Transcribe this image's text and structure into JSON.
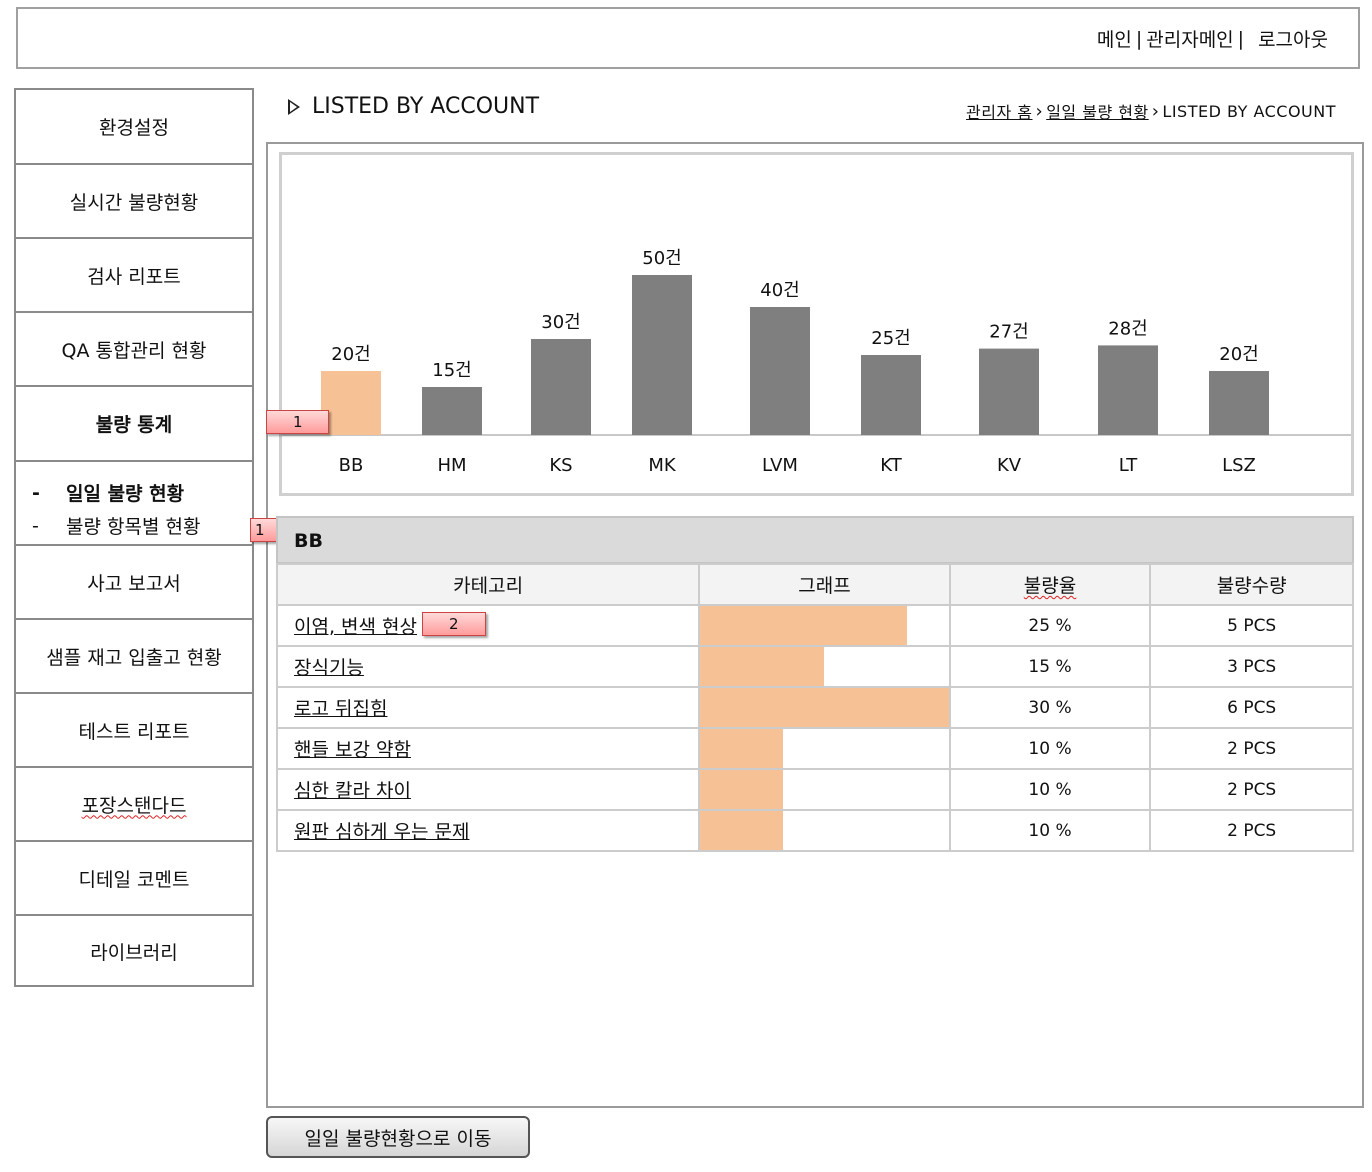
{
  "header": {
    "nav_main": "메인",
    "nav_sep1": "|",
    "nav_admin": "관리자메인",
    "nav_sep2": "|",
    "nav_logout": "로그아웃"
  },
  "sidebar": {
    "items": [
      {
        "label": "환경설정"
      },
      {
        "label": "실시간 불량현황"
      },
      {
        "label": "검사 리포트"
      },
      {
        "label": "QA 통합관리 현황"
      },
      {
        "label": "불량 통계"
      },
      {
        "label": "사고 보고서"
      },
      {
        "label": "샘플 재고 입출고 현황"
      },
      {
        "label": "테스트 리포트"
      },
      {
        "label": "포장스탠다드"
      },
      {
        "label": "디테일 코멘트"
      },
      {
        "label": "라이브러리"
      }
    ],
    "sub_items": [
      {
        "dash": "-",
        "label": "일일 불량 현황"
      },
      {
        "dash": "-",
        "label": "불량 항목별 현황"
      }
    ]
  },
  "page": {
    "title": "LISTED BY ACCOUNT",
    "breadcrumb": [
      "관리자 홈",
      "일일 불량 현황",
      "LISTED BY ACCOUNT"
    ]
  },
  "badges": {
    "chart_badge": "1",
    "sidebar_badge": "1",
    "row_badge": "2"
  },
  "colors": {
    "highlight": "#f6c195",
    "bar": "#7f7f7f"
  },
  "chart_data": {
    "type": "bar",
    "categories": [
      "BB",
      "HM",
      "KS",
      "MK",
      "LVM",
      "KT",
      "KV",
      "LT",
      "LSZ"
    ],
    "values": [
      20,
      15,
      30,
      50,
      40,
      25,
      27,
      28,
      20
    ],
    "data_labels": [
      "20건",
      "15건",
      "30건",
      "50건",
      "40건",
      "25건",
      "27건",
      "28건",
      "20건"
    ],
    "highlighted_category": "BB",
    "title": "",
    "xlabel": "",
    "ylabel": "",
    "grid": false
  },
  "detail": {
    "account": "BB",
    "columns": [
      "카테고리",
      "그래프",
      "불량율",
      "불량수량"
    ],
    "rows": [
      {
        "category": "이염, 변색 현상",
        "rate_value": 25,
        "rate": "25 %",
        "qty": "5 PCS"
      },
      {
        "category": "장식기능",
        "rate_value": 15,
        "rate": "15 %",
        "qty": "3 PCS"
      },
      {
        "category": "로고 뒤집힘",
        "rate_value": 30,
        "rate": "30 %",
        "qty": "6 PCS"
      },
      {
        "category": "핸들 보강 약함",
        "rate_value": 10,
        "rate": "10 %",
        "qty": "2 PCS"
      },
      {
        "category": "심한 칼라 차이",
        "rate_value": 10,
        "rate": "10 %",
        "qty": "2 PCS"
      },
      {
        "category": "원판 심하게 우는 문제",
        "rate_value": 10,
        "rate": "10 %",
        "qty": "2 PCS"
      }
    ]
  },
  "footer": {
    "go_button": "일일 불량현황으로 이동"
  }
}
